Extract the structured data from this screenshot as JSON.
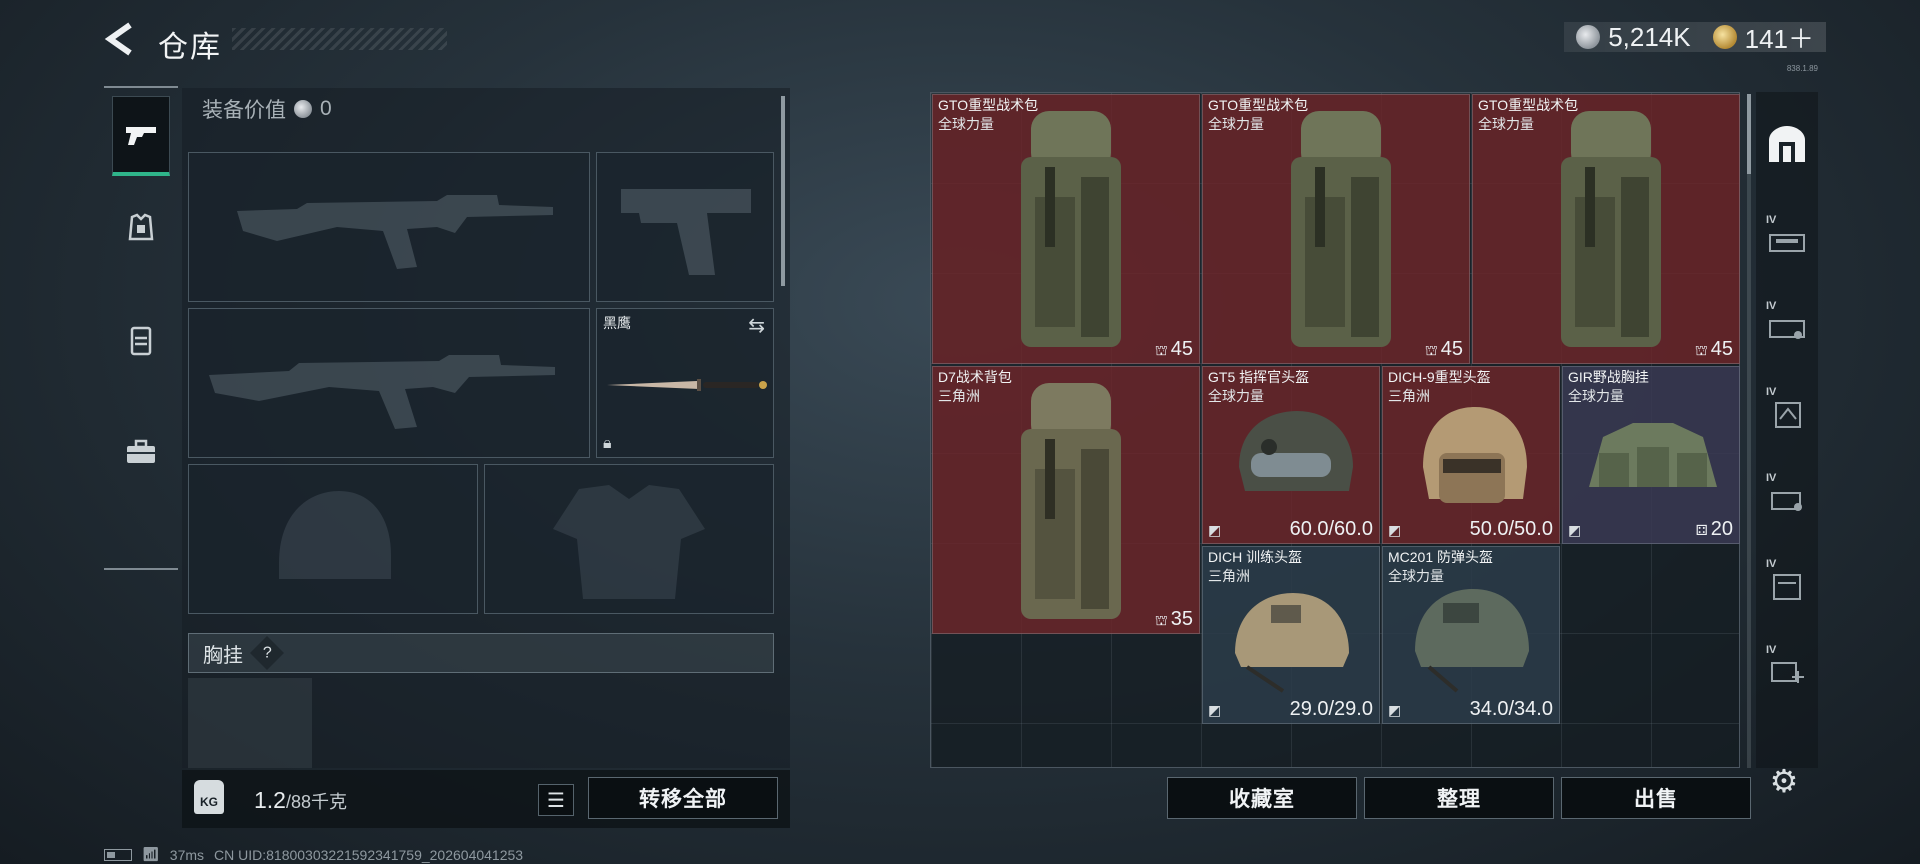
{
  "header": {
    "back_icon": "back-arrow-icon",
    "title": "仓库"
  },
  "currency": {
    "silver": "5,214K",
    "gold": "141＋",
    "silver_icon": "silver-coin-icon",
    "gold_icon": "gold-coin-icon"
  },
  "version_text": "838.1.89",
  "categories": [
    {
      "name": "pistol-icon",
      "active": true
    },
    {
      "name": "rig-icon",
      "active": false
    },
    {
      "name": "backpack-icon",
      "active": false
    },
    {
      "name": "briefcase-icon",
      "active": false
    }
  ],
  "equipment": {
    "value_label": "装备价值",
    "value": "0",
    "melee": {
      "label": "黑鹰"
    },
    "chest_rig_label": "胸挂",
    "help": "?"
  },
  "weight": {
    "current": "1.2",
    "max": "/88千克",
    "icon": "KG"
  },
  "buttons": {
    "transfer_all": "转移全部",
    "collection": "收藏室",
    "organize": "整理",
    "sell": "出售"
  },
  "status": {
    "ping": "37ms",
    "uid": "CN UID:8180030322159234175​9_202604041253"
  },
  "storage_items": [
    {
      "name": "GTO重型战术包",
      "sub": "全球力量",
      "count": "45"
    },
    {
      "name": "GTO重型战术包",
      "sub": "全球力量",
      "count": "45"
    },
    {
      "name": "GTO重型战术包",
      "sub": "全球力量",
      "count": "45"
    },
    {
      "name": "D7战术背包",
      "sub": "三角洲",
      "count": "35"
    },
    {
      "name": "GT5 指挥官头盔",
      "sub": "全球力量",
      "durability": "60.0/60.0"
    },
    {
      "name": "DICH-9重型头盔",
      "sub": "三角洲",
      "durability": "50.0/50.0"
    },
    {
      "name": "GIR野战胸挂",
      "sub": "全球力量",
      "count": "20"
    },
    {
      "name": "DICH 训练头盔",
      "sub": "三角洲",
      "durability": "29.0/29.0"
    },
    {
      "name": "MC201 防弹头盔",
      "sub": "全球力量",
      "durability": "34.0/34.0"
    }
  ],
  "storage_tabs": [
    {
      "name": "home-storage-icon"
    },
    {
      "label": "IV"
    },
    {
      "label": "IV"
    },
    {
      "label": "IV"
    },
    {
      "label": "IV"
    },
    {
      "label": "IV"
    },
    {
      "label": "IV"
    }
  ],
  "colors": {
    "accent": "#2fb58a",
    "red_rarity": "#6e262a",
    "purple_rarity": "#3a3a54"
  }
}
